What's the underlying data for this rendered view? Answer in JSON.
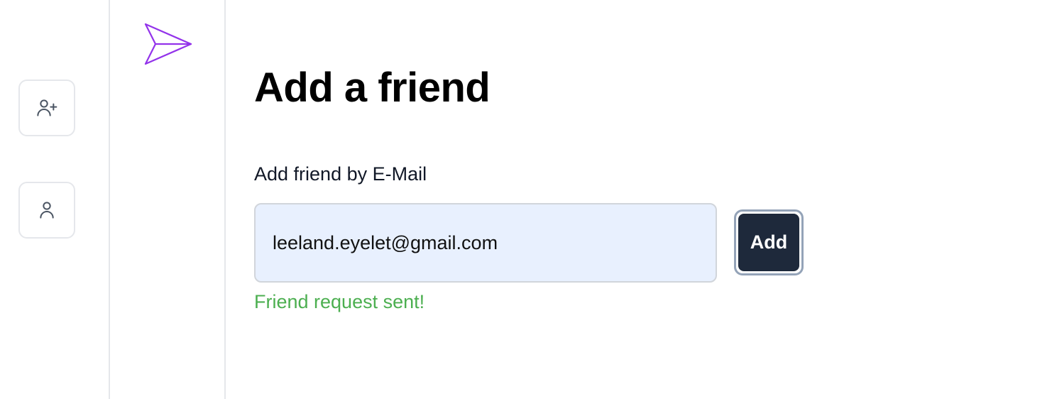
{
  "rail": {
    "items": [
      {
        "icon": "user-plus-icon"
      },
      {
        "icon": "user-icon"
      }
    ]
  },
  "logo": {
    "icon": "paper-plane-icon",
    "color": "#9333ea"
  },
  "main": {
    "title": "Add a friend",
    "field_label": "Add friend by E-Mail",
    "email_value": "leeland.eyelet@gmail.com",
    "add_button_label": "Add",
    "status_message": "Friend request sent!"
  },
  "colors": {
    "input_bg": "#e8f0fe",
    "button_bg": "#1e293b",
    "success": "#4caf50",
    "border": "#e5e7eb"
  }
}
